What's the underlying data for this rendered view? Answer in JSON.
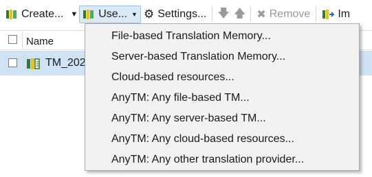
{
  "toolbar": {
    "create_label": "Create...",
    "use_label": "Use...",
    "settings_label": "Settings...",
    "remove_label": "Remove",
    "import_label": "Im"
  },
  "grid": {
    "header_name": "Name",
    "rows": [
      {
        "name": "TM_202"
      }
    ]
  },
  "use_menu": {
    "items": [
      "File-based Translation Memory...",
      "Server-based Translation Memory...",
      "Cloud-based resources...",
      "AnyTM: Any file-based TM...",
      "AnyTM: Any server-based TM...",
      "AnyTM: Any cloud-based resources...",
      "AnyTM: Any other translation provider..."
    ]
  },
  "colors": {
    "selected_row": "#cfe3f5",
    "active_button": "#dbe9f7",
    "menu_background": "#f2f2f2"
  },
  "icons": [
    "translation-memory-icon",
    "gear-icon",
    "arrow-down-icon",
    "arrow-up-icon",
    "remove-x-icon",
    "import-icon",
    "dropdown-arrow-icon"
  ]
}
